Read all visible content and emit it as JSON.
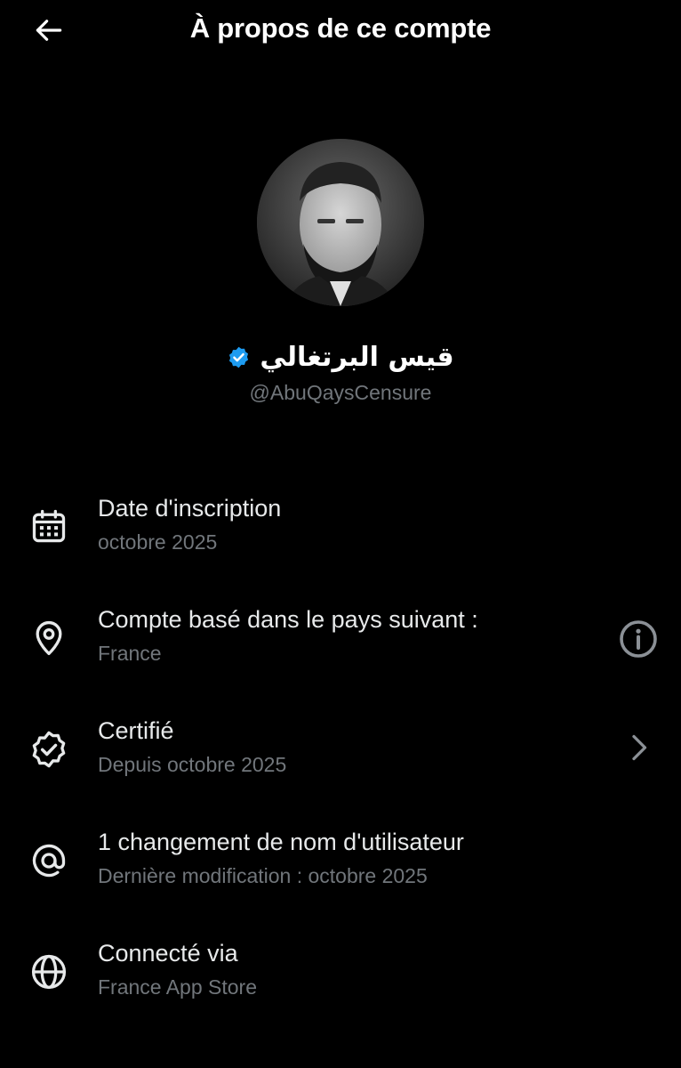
{
  "header": {
    "title": "À propos de ce compte",
    "back_icon": "arrow-left-icon"
  },
  "profile": {
    "display_name": "قيس البرتغالي",
    "handle": "@AbuQaysCensure",
    "verified": true,
    "verified_color": "#1d9bf0"
  },
  "details": [
    {
      "icon": "calendar-icon",
      "title": "Date d'inscription",
      "subtitle": "octobre 2025"
    },
    {
      "icon": "location-pin-icon",
      "title": "Compte basé dans le pays suivant :",
      "subtitle": "France",
      "action_icon": "info-icon"
    },
    {
      "icon": "verified-badge-icon",
      "title": "Certifié",
      "subtitle": "Depuis octobre 2025",
      "action_icon": "chevron-right-icon"
    },
    {
      "icon": "at-sign-icon",
      "title": "1 changement de nom d'utilisateur",
      "subtitle": "Dernière modification : octobre 2025"
    },
    {
      "icon": "globe-icon",
      "title": "Connecté via",
      "subtitle": "France App Store"
    }
  ],
  "colors": {
    "background": "#000000",
    "primary_text": "#e7e9ea",
    "secondary_text": "#71767b",
    "accent": "#1d9bf0"
  }
}
